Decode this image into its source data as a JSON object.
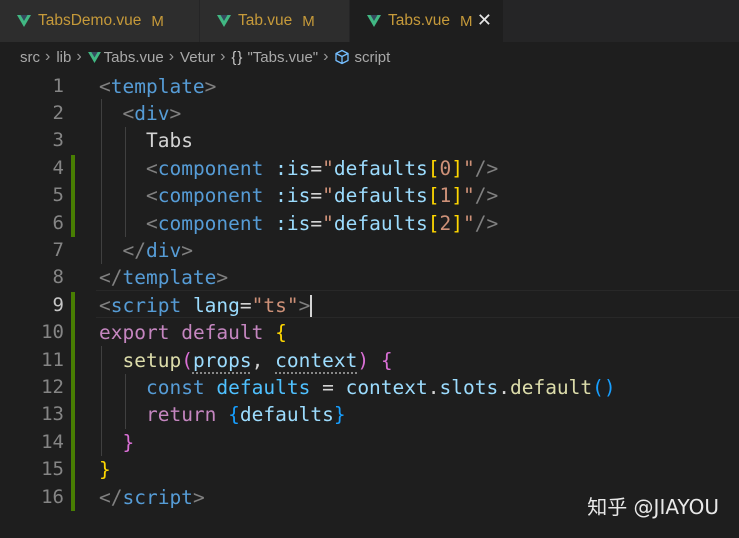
{
  "tabs": [
    {
      "label": "TabsDemo.vue",
      "status": "M",
      "active": false
    },
    {
      "label": "Tab.vue",
      "status": "M",
      "active": false
    },
    {
      "label": "Tabs.vue",
      "status": "M",
      "active": true
    }
  ],
  "close_glyph": "✕",
  "breadcrumb": {
    "items": [
      "src",
      "lib",
      "Tabs.vue",
      "Vetur",
      "\"Tabs.vue\"",
      "script"
    ],
    "separator": "›",
    "brace_glyph": "{}"
  },
  "editor": {
    "current_line": 9,
    "line_numbers": [
      "1",
      "2",
      "3",
      "4",
      "5",
      "6",
      "7",
      "8",
      "9",
      "10",
      "11",
      "12",
      "13",
      "14",
      "15",
      "16"
    ],
    "lines": [
      [
        {
          "t": "<",
          "c": "t-punc"
        },
        {
          "t": "template",
          "c": "t-tag"
        },
        {
          "t": ">",
          "c": "t-punc"
        }
      ],
      [
        {
          "t": "  "
        },
        {
          "t": "<",
          "c": "t-punc"
        },
        {
          "t": "div",
          "c": "t-tag"
        },
        {
          "t": ">",
          "c": "t-punc"
        }
      ],
      [
        {
          "t": "    "
        },
        {
          "t": "Tabs",
          "c": "t-text"
        }
      ],
      [
        {
          "t": "    "
        },
        {
          "t": "<",
          "c": "t-punc"
        },
        {
          "t": "component",
          "c": "t-tag"
        },
        {
          "t": " :is",
          "c": "t-attr"
        },
        {
          "t": "=",
          "c": "t-text"
        },
        {
          "t": "\"",
          "c": "t-str"
        },
        {
          "t": "defaults",
          "c": "t-var"
        },
        {
          "t": "[",
          "c": "t-b1"
        },
        {
          "t": "0",
          "c": "t-str"
        },
        {
          "t": "]",
          "c": "t-b1"
        },
        {
          "t": "\"",
          "c": "t-str"
        },
        {
          "t": "/>",
          "c": "t-punc"
        }
      ],
      [
        {
          "t": "    "
        },
        {
          "t": "<",
          "c": "t-punc"
        },
        {
          "t": "component",
          "c": "t-tag"
        },
        {
          "t": " :is",
          "c": "t-attr"
        },
        {
          "t": "=",
          "c": "t-text"
        },
        {
          "t": "\"",
          "c": "t-str"
        },
        {
          "t": "defaults",
          "c": "t-var"
        },
        {
          "t": "[",
          "c": "t-b1"
        },
        {
          "t": "1",
          "c": "t-str"
        },
        {
          "t": "]",
          "c": "t-b1"
        },
        {
          "t": "\"",
          "c": "t-str"
        },
        {
          "t": "/>",
          "c": "t-punc"
        }
      ],
      [
        {
          "t": "    "
        },
        {
          "t": "<",
          "c": "t-punc"
        },
        {
          "t": "component",
          "c": "t-tag"
        },
        {
          "t": " :is",
          "c": "t-attr"
        },
        {
          "t": "=",
          "c": "t-text"
        },
        {
          "t": "\"",
          "c": "t-str"
        },
        {
          "t": "defaults",
          "c": "t-var"
        },
        {
          "t": "[",
          "c": "t-b1"
        },
        {
          "t": "2",
          "c": "t-str"
        },
        {
          "t": "]",
          "c": "t-b1"
        },
        {
          "t": "\"",
          "c": "t-str"
        },
        {
          "t": "/>",
          "c": "t-punc"
        }
      ],
      [
        {
          "t": "  "
        },
        {
          "t": "</",
          "c": "t-punc"
        },
        {
          "t": "div",
          "c": "t-tag"
        },
        {
          "t": ">",
          "c": "t-punc"
        }
      ],
      [
        {
          "t": "</",
          "c": "t-punc"
        },
        {
          "t": "template",
          "c": "t-tag"
        },
        {
          "t": ">",
          "c": "t-punc"
        }
      ],
      [
        {
          "t": "<",
          "c": "t-punc"
        },
        {
          "t": "script",
          "c": "t-tag"
        },
        {
          "t": " lang",
          "c": "t-attr"
        },
        {
          "t": "=",
          "c": "t-text"
        },
        {
          "t": "\"ts\"",
          "c": "t-str"
        },
        {
          "t": ">",
          "c": "t-punc"
        },
        {
          "cursor": true
        }
      ],
      [
        {
          "t": "export",
          "c": "t-kw"
        },
        {
          "t": " "
        },
        {
          "t": "default",
          "c": "t-kw"
        },
        {
          "t": " "
        },
        {
          "t": "{",
          "c": "t-b1"
        }
      ],
      [
        {
          "t": "  "
        },
        {
          "t": "setup",
          "c": "t-fn"
        },
        {
          "t": "(",
          "c": "t-b2"
        },
        {
          "t": "props",
          "c": "t-dim"
        },
        {
          "t": ", ",
          "c": "t-text"
        },
        {
          "t": "context",
          "c": "t-dim"
        },
        {
          "t": ")",
          "c": "t-b2"
        },
        {
          "t": " "
        },
        {
          "t": "{",
          "c": "t-b2"
        }
      ],
      [
        {
          "t": "    "
        },
        {
          "t": "const",
          "c": "t-kwb"
        },
        {
          "t": " "
        },
        {
          "t": "defaults",
          "c": "t-const"
        },
        {
          "t": " = ",
          "c": "t-text"
        },
        {
          "t": "context",
          "c": "t-var"
        },
        {
          "t": ".",
          "c": "t-text"
        },
        {
          "t": "slots",
          "c": "t-var"
        },
        {
          "t": ".",
          "c": "t-text"
        },
        {
          "t": "default",
          "c": "t-fn"
        },
        {
          "t": "()",
          "c": "t-b3"
        }
      ],
      [
        {
          "t": "    "
        },
        {
          "t": "return",
          "c": "t-kw"
        },
        {
          "t": " "
        },
        {
          "t": "{",
          "c": "t-b3"
        },
        {
          "t": "defaults",
          "c": "t-var"
        },
        {
          "t": "}",
          "c": "t-b3"
        }
      ],
      [
        {
          "t": "  "
        },
        {
          "t": "}",
          "c": "t-b2"
        }
      ],
      [
        {
          "t": "}",
          "c": "t-b1"
        }
      ],
      [
        {
          "t": "</",
          "c": "t-punc"
        },
        {
          "t": "script",
          "c": "t-tag"
        },
        {
          "t": ">",
          "c": "t-punc"
        }
      ]
    ]
  },
  "watermark": "知乎 @JIAYOU",
  "colors": {
    "vue_green": "#41b883",
    "modified": "#c69a3a",
    "git_added": "#487e02"
  }
}
